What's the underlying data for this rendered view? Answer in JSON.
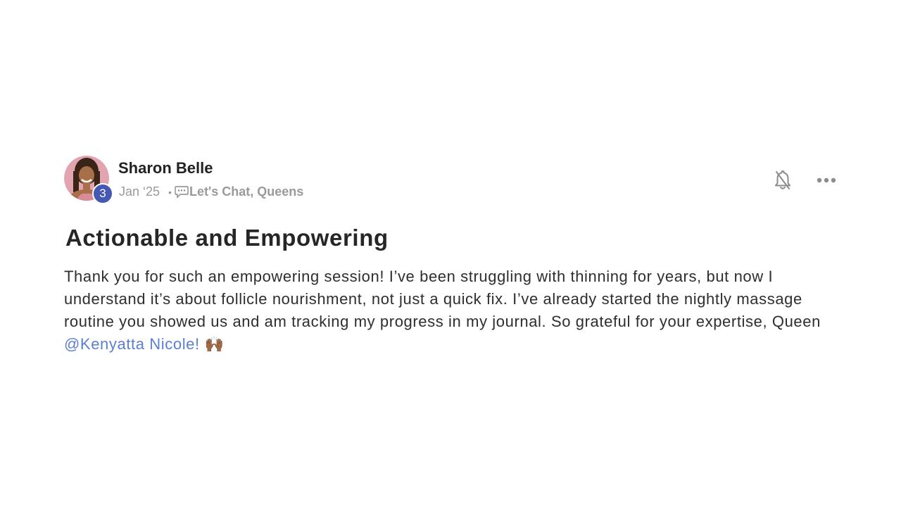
{
  "post": {
    "author": {
      "name": "Sharon Belle",
      "level": "3"
    },
    "date": "Jan ‘25",
    "separator": "•",
    "category": "Let's Chat, Queens",
    "title": "Actionable and Empowering",
    "body_text": "Thank you for such an empowering session! I’ve been struggling with thinning for years, but now I understand it’s about follicle nourishment, not just a quick fix. I’ve already started the nightly massage routine you showed us and am tracking my progress in my journal. So grateful for your expertise, Queen ",
    "mention": "@Kenyatta Nicole!",
    "emoji": "🙌🏾"
  },
  "icons": {
    "category": "speech-bubble-icon",
    "notify": "bell-off-icon",
    "more": "more-horizontal-icon"
  },
  "colors": {
    "level_badge": "#4558b4",
    "mention": "#5b7fd3",
    "meta": "#9a9a9a"
  }
}
